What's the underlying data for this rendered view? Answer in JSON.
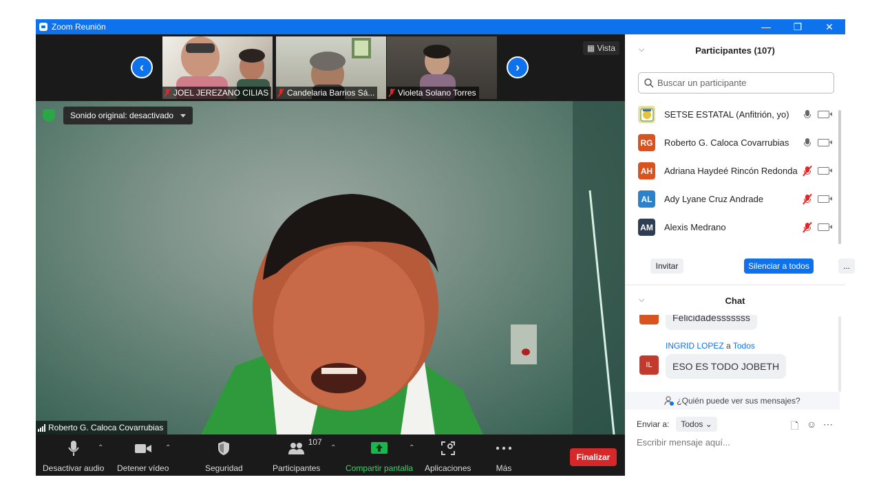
{
  "window": {
    "title": "Zoom Reunión",
    "controls": [
      "—",
      "❐",
      "✕"
    ]
  },
  "thumbnails": [
    {
      "name": "JOEL JEREZANO CILIAS"
    },
    {
      "name": "Candelaria Barrios Sá..."
    },
    {
      "name": "Violeta Solano Torres"
    }
  ],
  "view_button": "Vista",
  "sound_original": "Sonido original: desactivado",
  "active_speaker": "Roberto G. Caloca Covarrubias",
  "toolbar": {
    "mute": "Desactivar audio",
    "video": "Detener vídeo",
    "security": "Seguridad",
    "participants": "Participantes",
    "participants_count": "107",
    "share": "Compartir pantalla",
    "apps": "Aplicaciones",
    "more": "Más",
    "end": "Finalizar"
  },
  "participants_panel": {
    "title": "Participantes (107)",
    "search_placeholder": "Buscar un participante",
    "list": [
      {
        "initials": "",
        "name": "SETSE ESTATAL (Anfitrión, yo)",
        "color": "#e8e0a0",
        "muted": false
      },
      {
        "initials": "RG",
        "name": "Roberto G. Caloca Covarrubias",
        "color": "#d9531e",
        "muted": false
      },
      {
        "initials": "AH",
        "name": "Adriana Haydeé Rincón Redonda",
        "color": "#d9531e",
        "muted": true
      },
      {
        "initials": "AL",
        "name": "Ady Lyane Cruz Andrade",
        "color": "#2b82c9",
        "muted": true
      },
      {
        "initials": "AM",
        "name": "Alexis Medrano",
        "color": "#2f3d55",
        "muted": true
      }
    ],
    "invite": "Invitar",
    "mute_all": "Silenciar a todos",
    "more": "..."
  },
  "chat": {
    "title": "Chat",
    "partial_message": "Felicidadesssssss",
    "sender": "INGRID LOPEZ",
    "to_word": "a",
    "recipient": "Todos",
    "message_initials": "IL",
    "message": "ESO ES TODO JOBETH",
    "who_can_see": "¿Quién puede ver sus mensajes?",
    "send_to_label": "Enviar a:",
    "send_to_value": "Todos",
    "input_placeholder": "Escribir mensaje aquí..."
  }
}
